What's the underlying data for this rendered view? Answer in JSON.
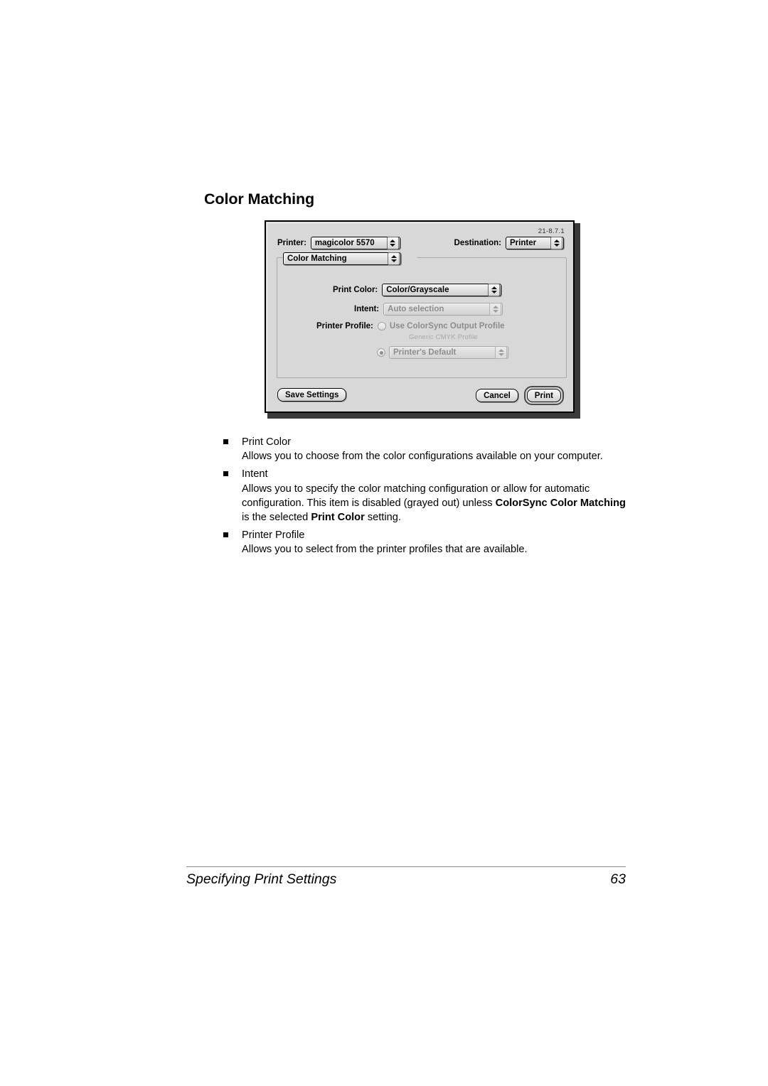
{
  "page": {
    "heading": "Color Matching",
    "footer_title": "Specifying Print Settings",
    "footer_page": "63"
  },
  "dialog": {
    "version": "21-8.7.1",
    "printer_label": "Printer:",
    "printer_value": "magicolor 5570",
    "destination_label": "Destination:",
    "destination_value": "Printer",
    "pane_value": "Color Matching",
    "print_color_label": "Print Color:",
    "print_color_value": "Color/Grayscale",
    "intent_label": "Intent:",
    "intent_value": "Auto selection",
    "printer_profile_label": "Printer Profile:",
    "colorsync_radio_label": "Use ColorSync Output Profile",
    "colorsync_subnote": "Generic CMYK Profile",
    "printers_default_value": "Printer's Default",
    "save_settings_label": "Save Settings",
    "cancel_label": "Cancel",
    "print_label": "Print"
  },
  "content": {
    "bullets": [
      {
        "term": "Print Color",
        "desc_parts": [
          {
            "text": "Allows you to choose from the color configurations available on your computer.",
            "bold": false
          }
        ]
      },
      {
        "term": "Intent",
        "desc_parts": [
          {
            "text": "Allows you to specify the color matching configuration or allow for automatic configuration. This item is disabled (grayed out) unless ",
            "bold": false
          },
          {
            "text": "ColorSync Color Matching",
            "bold": true
          },
          {
            "text": " is the selected ",
            "bold": false
          },
          {
            "text": "Print Color",
            "bold": true
          },
          {
            "text": " setting.",
            "bold": false
          }
        ]
      },
      {
        "term": "Printer Profile",
        "desc_parts": [
          {
            "text": "Allows you to select from the printer profiles that are available.",
            "bold": false
          }
        ]
      }
    ]
  },
  "colors": {
    "dialog_bg": "#d8d8d8",
    "dialog_border": "#000000",
    "disabled_text": "#8c8c8c",
    "subnote_text": "#a8a8a8"
  }
}
